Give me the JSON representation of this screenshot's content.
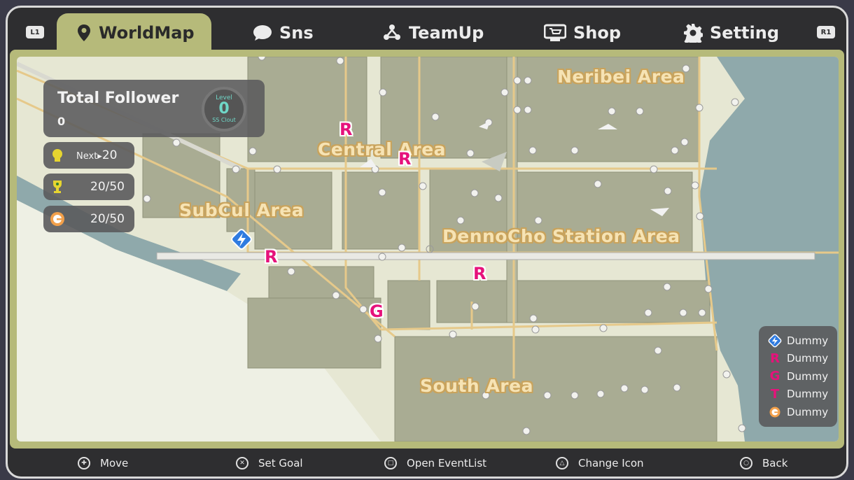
{
  "tabs": {
    "shoulder_left": "L1",
    "shoulder_right": "R1",
    "items": [
      {
        "label": "WorldMap",
        "icon": "map-pin-icon",
        "active": true
      },
      {
        "label": "Sns",
        "icon": "speech-bubble-icon",
        "active": false
      },
      {
        "label": "TeamUp",
        "icon": "team-icon",
        "active": false
      },
      {
        "label": "Shop",
        "icon": "shop-cart-icon",
        "active": false
      },
      {
        "label": "Setting",
        "icon": "gear-icon",
        "active": false
      }
    ]
  },
  "follower": {
    "title": "Total Follower",
    "count": "0",
    "level_label": "Level",
    "level": "0",
    "clout": "SS Clout"
  },
  "stats": {
    "next_prefix": "Next▸",
    "next_value": "20",
    "trophy_progress": "20/50",
    "coin_progress": "20/50"
  },
  "areas": {
    "neribei": "Neribei Area",
    "central": "Central Area",
    "subcul": "SubCul Area",
    "dennocho": "DennoCho Station Area",
    "south": "South Area"
  },
  "markers": {
    "r": "R",
    "g": "G"
  },
  "legend": [
    {
      "icon": "blue-flash-icon",
      "label": "Dummy"
    },
    {
      "icon": "r-icon",
      "glyph": "R",
      "label": "Dummy"
    },
    {
      "icon": "g-icon",
      "glyph": "G",
      "label": "Dummy"
    },
    {
      "icon": "t-icon",
      "glyph": "T",
      "label": "Dummy"
    },
    {
      "icon": "coin-icon",
      "label": "Dummy"
    }
  ],
  "hints": {
    "move": "Move",
    "set_goal": "Set Goal",
    "open_eventlist": "Open EventList",
    "change_icon": "Change Icon",
    "back": "Back"
  },
  "colors": {
    "accent": "#b6ba7a",
    "marker_pink": "#e6127b",
    "water": "#8fa9ab",
    "block": "#a9ac93",
    "road": "#e6c98a"
  }
}
